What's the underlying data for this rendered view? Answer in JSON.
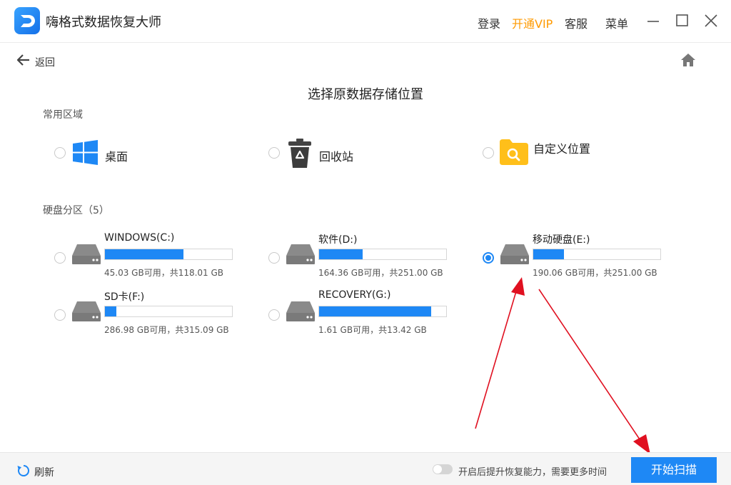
{
  "app": {
    "title": "嗨格式数据恢复大师"
  },
  "header": {
    "menu": [
      "登录",
      "开通VIP",
      "客服",
      "菜单"
    ]
  },
  "nav": {
    "back_label": "返回"
  },
  "page": {
    "title": "选择原数据存储位置"
  },
  "common": {
    "section_label": "常用区域",
    "items": [
      {
        "label": "桌面",
        "icon": "windows-icon",
        "selected": false
      },
      {
        "label": "回收站",
        "icon": "recycle-bin-icon",
        "selected": false
      },
      {
        "label": "自定义位置",
        "icon": "folder-search-icon",
        "selected": false
      }
    ]
  },
  "drives": {
    "section_label": "硬盘分区（5）",
    "items": [
      {
        "name": "WINDOWS(C:)",
        "info": "45.03 GB可用，共118.01 GB",
        "used_fraction": 0.618,
        "selected": false
      },
      {
        "name": "软件(D:)",
        "info": "164.36 GB可用，共251.00 GB",
        "used_fraction": 0.345,
        "selected": false
      },
      {
        "name": "移动硬盘(E:)",
        "info": "190.06 GB可用，共251.00 GB",
        "used_fraction": 0.243,
        "selected": true
      },
      {
        "name": "SD卡(F:)",
        "info": "286.98 GB可用，共315.09 GB",
        "used_fraction": 0.089,
        "selected": false
      },
      {
        "name": "RECOVERY(G:)",
        "info": "1.61 GB可用，共13.42 GB",
        "used_fraction": 0.88,
        "selected": false
      }
    ]
  },
  "footer": {
    "refresh_label": "刷新",
    "toggle_label": "开启后提升恢复能力，需要更多时间",
    "toggle_on": false,
    "scan_label": "开始扫描"
  },
  "colors": {
    "accent": "#1e88f5",
    "vip": "#ff9a00",
    "annotation": "#e01020"
  }
}
